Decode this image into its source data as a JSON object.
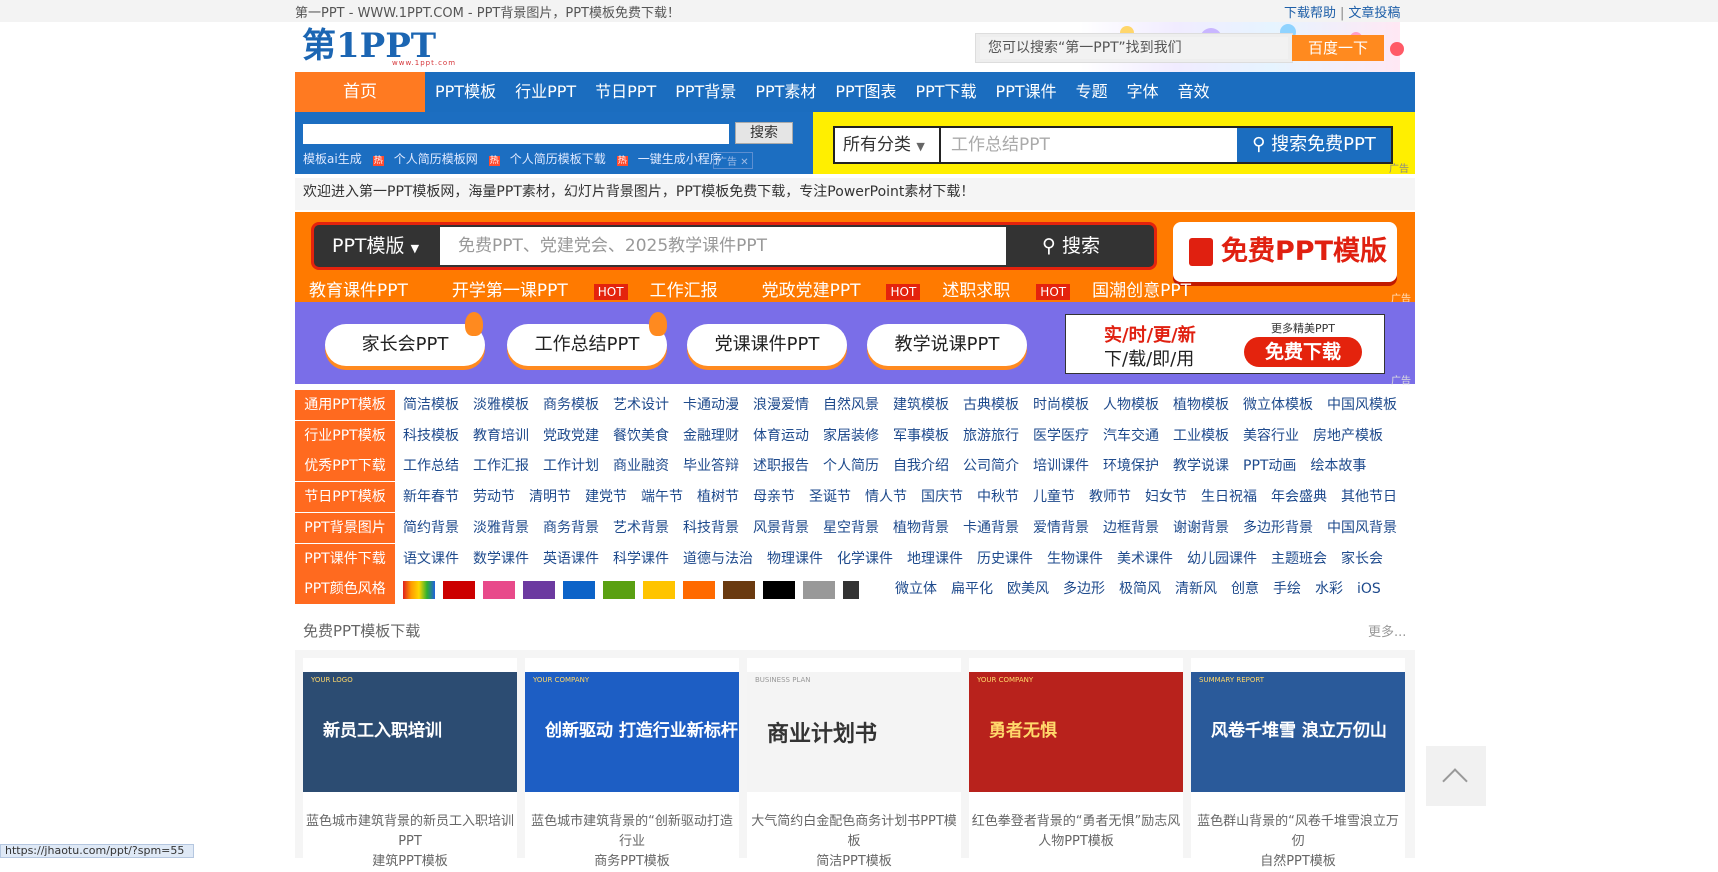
{
  "topbar": {
    "title": "第一PPT - WWW.1PPT.COM - PPT背景图片，PPT模板免费下载！",
    "help": "下载帮助",
    "sep": "|",
    "contribute": "文章投稿"
  },
  "logo": {
    "text": "第1PPT",
    "url": "www.1ppt.com"
  },
  "header_search": {
    "placeholder": "您可以搜索“第一PPT”找到我们",
    "button": "百度一下"
  },
  "nav": {
    "home": "首页",
    "items": [
      "PPT模板",
      "行业PPT",
      "节日PPT",
      "PPT背景",
      "PPT素材",
      "PPT图表",
      "PPT下载",
      "PPT课件",
      "专题",
      "字体",
      "音效"
    ]
  },
  "ad_search": {
    "button": "搜索",
    "links": [
      "模板ai生成",
      "个人简历模板网",
      "个人简历模板下载",
      "一键生成小程序"
    ],
    "hot": "热",
    "ad": "广告",
    "close": "✕"
  },
  "ad_search2": {
    "category": "所有分类",
    "placeholder": "工作总结PPT",
    "button": "搜索免费PPT",
    "ad": "广告"
  },
  "welcome": "欢迎进入第一PPT模板网，海量PPT素材，幻灯片背景图片，PPT模板免费下载，专注PowerPoint素材下载！",
  "banner1": {
    "label": "PPT模版",
    "placeholder": "免费PPT、党建党会、2025教学课件PPT",
    "search": "搜索",
    "free": "免费PPT模版",
    "hot_links": [
      {
        "t": "教育课件PPT",
        "hot": ""
      },
      {
        "t": "开学第一课PPT",
        "hot": "HOT"
      },
      {
        "t": "工作汇报",
        "hot": ""
      },
      {
        "t": "党政党建PPT",
        "hot": "HOT"
      },
      {
        "t": "述职求职",
        "hot": "HOT"
      },
      {
        "t": "国潮创意PPT",
        "hot": ""
      }
    ],
    "ad": "广告"
  },
  "banner2": {
    "pills": [
      "家长会PPT",
      "工作总结PPT",
      "党课课件PPT",
      "教学说课PPT"
    ],
    "line1": "实/时/更/新",
    "line2": "下/载/即/用",
    "more": "更多精美PPT",
    "download": "免费下载",
    "ad": "广告"
  },
  "categories": [
    {
      "head": "通用PPT模板",
      "links": [
        "简洁模板",
        "淡雅模板",
        "商务模板",
        "艺术设计",
        "卡通动漫",
        "浪漫爱情",
        "自然风景",
        "建筑模板",
        "古典模板",
        "时尚模板",
        "人物模板",
        "植物模板",
        "微立体模板",
        "中国风模板"
      ]
    },
    {
      "head": "行业PPT模板",
      "links": [
        "科技模板",
        "教育培训",
        "党政党建",
        "餐饮美食",
        "金融理财",
        "体育运动",
        "家居装修",
        "军事模板",
        "旅游旅行",
        "医学医疗",
        "汽车交通",
        "工业模板",
        "美容行业",
        "房地产模板"
      ]
    },
    {
      "head": "优秀PPT下载",
      "links": [
        "工作总结",
        "工作汇报",
        "工作计划",
        "商业融资",
        "毕业答辩",
        "述职报告",
        "个人简历",
        "自我介绍",
        "公司简介",
        "培训课件",
        "环境保护",
        "教学说课",
        "PPT动画",
        "绘本故事"
      ]
    },
    {
      "head": "节日PPT模板",
      "links": [
        "新年春节",
        "劳动节",
        "清明节",
        "建党节",
        "端午节",
        "植树节",
        "母亲节",
        "圣诞节",
        "情人节",
        "国庆节",
        "中秋节",
        "儿童节",
        "教师节",
        "妇女节",
        "生日祝福",
        "年会盛典",
        "其他节日"
      ]
    },
    {
      "head": "PPT背景图片",
      "links": [
        "简约背景",
        "淡雅背景",
        "商务背景",
        "艺术背景",
        "科技背景",
        "风景背景",
        "星空背景",
        "植物背景",
        "卡通背景",
        "爱情背景",
        "边框背景",
        "谢谢背景",
        "多边形背景",
        "中国风背景"
      ]
    },
    {
      "head": "PPT课件下载",
      "links": [
        "语文课件",
        "数学课件",
        "英语课件",
        "科学课件",
        "道德与法治",
        "物理课件",
        "化学课件",
        "地理课件",
        "历史课件",
        "生物课件",
        "美术课件",
        "幼儿园课件",
        "主题班会",
        "家长会"
      ]
    }
  ],
  "colors": {
    "head": "PPT颜色风格",
    "swatches": [
      "#cc0000",
      "#e84a8a",
      "#6c3aa0",
      "#0c63c8",
      "#5aa012",
      "#ffc400",
      "#ff6a00",
      "#6a3a10",
      "#000000",
      "#999999"
    ],
    "styles": [
      "微立体",
      "扁平化",
      "欧美风",
      "多边形",
      "极简风",
      "清新风",
      "创意",
      "手绘",
      "水彩",
      "iOS"
    ]
  },
  "section": {
    "title": "免费PPT模板下载",
    "more": "更多..."
  },
  "cards": [
    {
      "img_title": "新员工入职培训",
      "logo": "YOUR LOGO",
      "cap1": "蓝色城市建筑背景的新员工入职培训PPT",
      "cap2": "建筑PPT模板",
      "bg": "#2c4c72"
    },
    {
      "img_title": "创新驱动 打造行业新标杆",
      "logo": "YOUR COMPANY",
      "cap1": "蓝色城市建筑背景的“创新驱动打造行业",
      "cap2": "商务PPT模板",
      "bg": "#1d5ec4"
    },
    {
      "img_title": "商业计划书",
      "logo": "BUSINESS PLAN",
      "cap1": "大气简约白金配色商务计划书PPT模板",
      "cap2": "简洁PPT模板",
      "bg": "#f4f4f4"
    },
    {
      "img_title": "勇者无惧",
      "logo": "YOUR COMPANY",
      "cap1": "红色拳登者背景的“勇者无惧”励志风",
      "cap2": "人物PPT模板",
      "bg": "#b8221c"
    },
    {
      "img_title": "风卷千堆雪 浪立万仞山",
      "logo": "SUMMARY REPORT",
      "cap1": "蓝色群山背景的“风卷千堆雪浪立万仞",
      "cap2": "自然PPT模板",
      "bg": "#2a5a9a"
    }
  ],
  "status_url": "https://jhaotu.com/ppt/?spm=55"
}
